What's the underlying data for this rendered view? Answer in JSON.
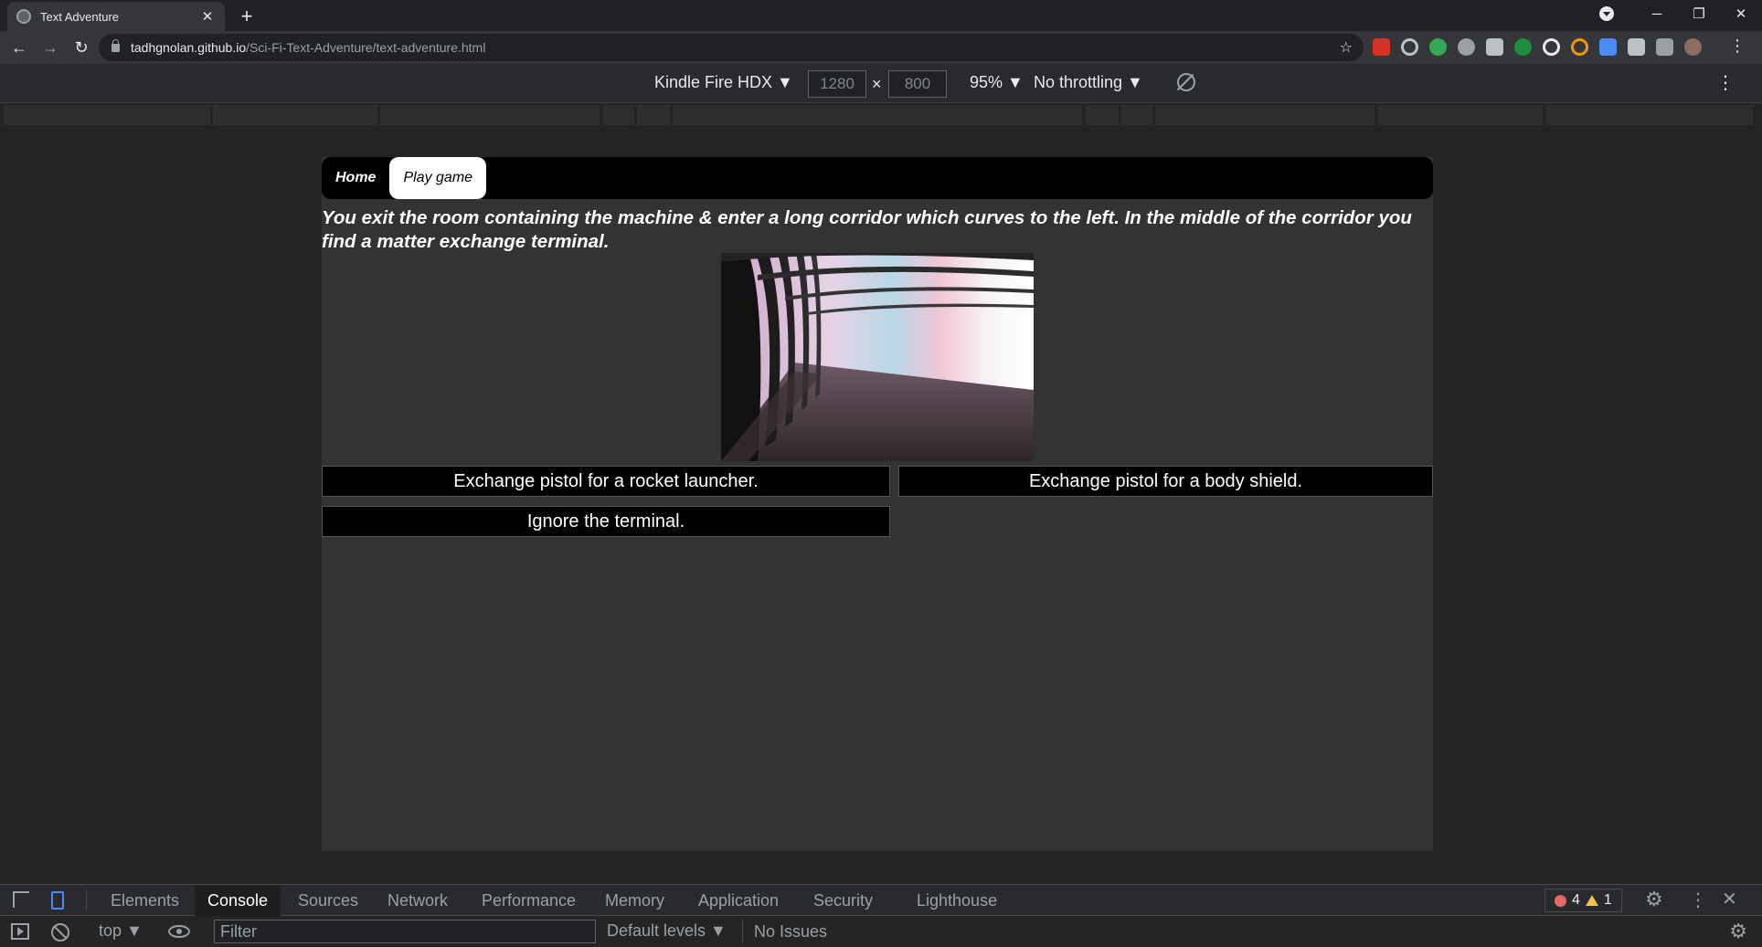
{
  "browser": {
    "tab_title": "Text Adventure",
    "new_tab_label": "+",
    "close_tab_label": "✕",
    "url_host": "tadhgnolan.github.io",
    "url_path": "/Sci-Fi-Text-Adventure/text-adventure.html"
  },
  "device_toolbar": {
    "device": "Kindle Fire HDX ▼",
    "width": "1280",
    "height": "800",
    "times": "×",
    "zoom": "95% ▼",
    "throttling": "No throttling ▼"
  },
  "game": {
    "nav": {
      "home": "Home",
      "play": "Play game"
    },
    "story": "You exit the room containing the machine & enter a long corridor which curves to the left. In the middle of the corridor you find a matter exchange terminal.",
    "choices": {
      "one": "Exchange pistol for a rocket launcher.",
      "two": "Exchange pistol for a body shield.",
      "three": "Ignore the terminal."
    }
  },
  "devtools": {
    "tabs": {
      "elements": "Elements",
      "console": "Console",
      "sources": "Sources",
      "network": "Network",
      "performance": "Performance",
      "memory": "Memory",
      "application": "Application",
      "security": "Security",
      "lighthouse": "Lighthouse"
    },
    "error_count": "4",
    "warning_count": "1",
    "context": "top ▼",
    "filter_placeholder": "Filter",
    "levels": "Default levels ▼",
    "issues": "No Issues"
  },
  "colors": {
    "page_bg": "#333333",
    "nav_bg": "#000000",
    "accent_blue": "#4c8bf5",
    "error_red": "#e46962",
    "warning_yellow": "#f2c14e"
  }
}
